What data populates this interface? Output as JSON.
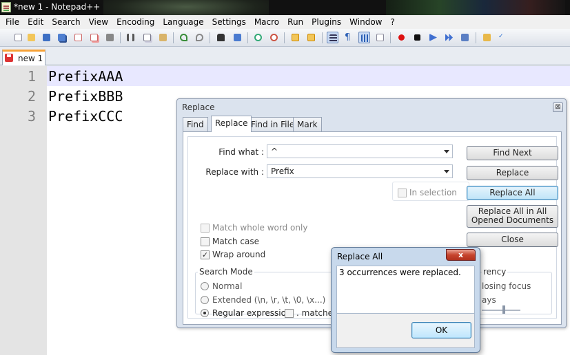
{
  "window": {
    "title": "*new  1 - Notepad++"
  },
  "menu": [
    "File",
    "Edit",
    "Search",
    "View",
    "Encoding",
    "Language",
    "Settings",
    "Macro",
    "Run",
    "Plugins",
    "Window",
    "?"
  ],
  "toolbar": {
    "icons": [
      "new-file-icon",
      "open-file-icon",
      "save-icon",
      "save-all-icon",
      "close-icon",
      "close-all-icon",
      "print-icon",
      "cut-icon",
      "copy-icon",
      "paste-icon",
      "undo-icon",
      "redo-icon",
      "find-icon",
      "replace-icon",
      "zoom-in-icon",
      "zoom-out-icon",
      "sync-vertical-icon",
      "sync-horizontal-icon",
      "word-wrap-icon",
      "show-all-characters-icon",
      "indent-guide-icon",
      "doc-map-icon",
      "record-macro-icon",
      "stop-macro-icon",
      "play-macro-icon",
      "run-macro-multiple-icon",
      "save-macro-icon",
      "file-browser-icon",
      "spell-check-icon"
    ]
  },
  "tabs": [
    {
      "label": "new  1"
    }
  ],
  "editor": {
    "lines": [
      {
        "num": "1",
        "text": "PrefixAAA"
      },
      {
        "num": "2",
        "text": "PrefixBBB"
      },
      {
        "num": "3",
        "text": "PrefixCCC"
      }
    ]
  },
  "replace_dialog": {
    "title": "Replace",
    "close_glyph": "⊠",
    "tabs": [
      "Find",
      "Replace",
      "Find in Files",
      "Mark"
    ],
    "active_tab": "Replace",
    "find_what_label": "Find what :",
    "find_what_value": "^",
    "replace_with_label": "Replace with :",
    "replace_with_value": "Prefix",
    "in_selection_label": "In selection",
    "buttons": {
      "find_next": "Find Next",
      "replace": "Replace",
      "replace_all": "Replace All",
      "replace_all_opened": "Replace All in All Opened Documents",
      "close": "Close"
    },
    "options": {
      "match_whole_word": {
        "label": "Match whole word only",
        "checked": false
      },
      "match_case": {
        "label": "Match case",
        "checked": false
      },
      "wrap_around": {
        "label": "Wrap around",
        "checked": true
      }
    },
    "search_mode": {
      "title": "Search Mode",
      "normal": "Normal",
      "extended": "Extended (\\n, \\r, \\t, \\0, \\x...)",
      "regex": "Regular expression",
      "selected": "regex",
      "dot_matches_newline": ". matches ne"
    },
    "transparency": {
      "title_partial": "rency",
      "on_losing_focus_partial": "losing focus",
      "always_partial": "ays"
    }
  },
  "message_box": {
    "title": "Replace All",
    "close_glyph": "x",
    "text": "3 occurrences were replaced.",
    "ok_label": "OK"
  }
}
